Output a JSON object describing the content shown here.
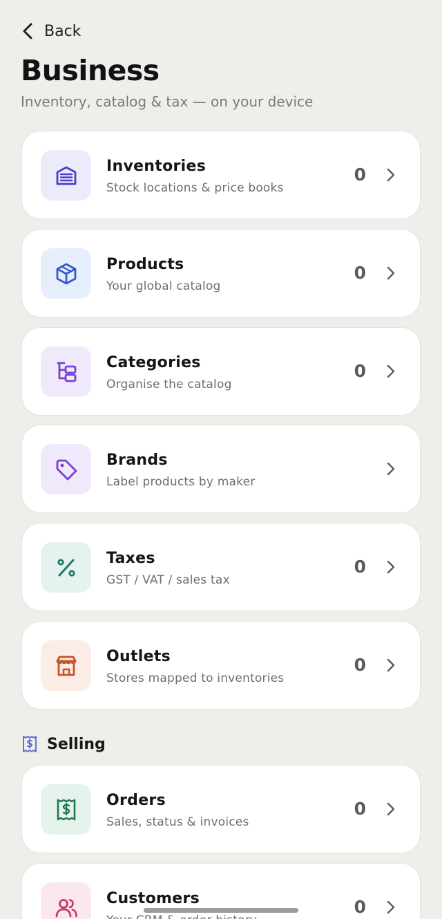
{
  "nav": {
    "back_label": "Back"
  },
  "header": {
    "title": "Business",
    "subtitle": "Inventory, catalog & tax — on your device"
  },
  "cards": [
    {
      "label": "Inventories",
      "desc": "Stock locations & price books",
      "count": "0",
      "icon": "warehouse-icon",
      "bg": "#ecebfb",
      "fg": "#4b3fc9"
    },
    {
      "label": "Products",
      "desc": "Your global catalog",
      "count": "0",
      "icon": "box-icon",
      "bg": "#e6eefb",
      "fg": "#2f5bd0"
    },
    {
      "label": "Categories",
      "desc": "Organise the catalog",
      "count": "0",
      "icon": "category-tree-icon",
      "bg": "#f0e8fb",
      "fg": "#7a3fd0"
    },
    {
      "label": "Brands",
      "desc": "Label products by maker",
      "count": "",
      "icon": "tag-icon",
      "bg": "#f0e8fb",
      "fg": "#7a3fd0"
    },
    {
      "label": "Taxes",
      "desc": "GST / VAT / sales tax",
      "count": "0",
      "icon": "percent-icon",
      "bg": "#e6f2ef",
      "fg": "#1f7a64"
    },
    {
      "label": "Outlets",
      "desc": "Stores mapped to inventories",
      "count": "0",
      "icon": "store-icon",
      "bg": "#fbece6",
      "fg": "#c5532a"
    }
  ],
  "selling_section": {
    "title": "Selling",
    "icon": "receipt-dollar-icon",
    "color": "#5563d6"
  },
  "selling_cards": [
    {
      "label": "Orders",
      "desc": "Sales, status & invoices",
      "count": "0",
      "icon": "receipt-dollar-icon",
      "bg": "#e6f2ec",
      "fg": "#1f7a52"
    },
    {
      "label": "Customers",
      "desc": "Your CRM & order history",
      "count": "0",
      "icon": "users-icon",
      "bg": "#fbe8ef",
      "fg": "#c23a6a"
    }
  ]
}
